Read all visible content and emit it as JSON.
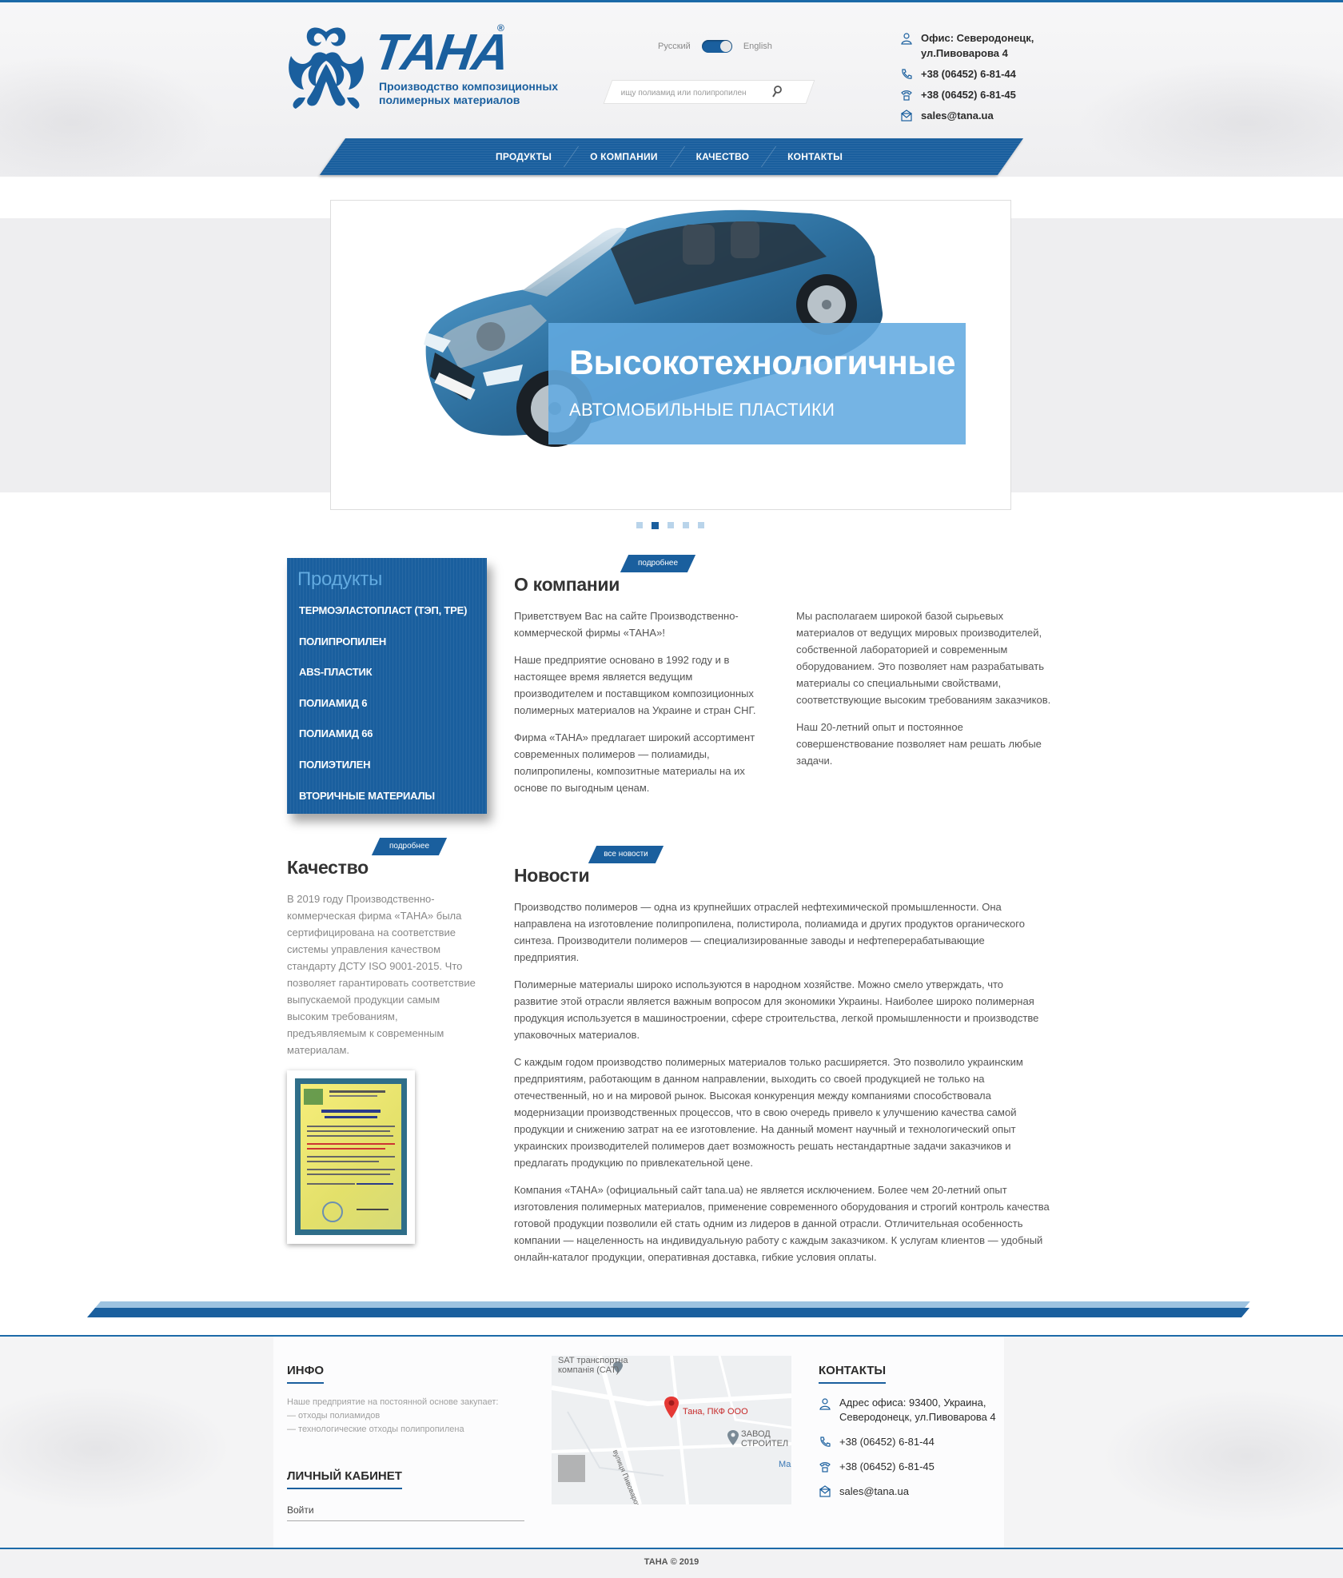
{
  "brand": {
    "logo_word": "ТАНА",
    "registered": "®",
    "tagline": "Производство композиционных полимерных материалов",
    "primary_color": "#1a5f9e",
    "accent_color": "#62aae0"
  },
  "language": {
    "ru": "Русский",
    "en": "English"
  },
  "search": {
    "placeholder": "ищу полиамид или полипропилен"
  },
  "header_contacts": {
    "office": "Офис: Северодонецк, ул.Пивоварова 4",
    "phone1": "+38 (06452) 6-81-44",
    "phone2": "+38 (06452) 6-81-45",
    "email": "sales@tana.ua"
  },
  "nav": {
    "items": [
      "ПРОДУКТЫ",
      "О КОМПАНИИ",
      "КАЧЕСТВО",
      "КОНТАКТЫ"
    ]
  },
  "slider": {
    "title": "Высокотехнологичные",
    "subtitle": "АВТОМОБИЛЬНЫЕ ПЛАСТИКИ",
    "active_index": 1,
    "count": 5
  },
  "products": {
    "title": "Продукты",
    "items": [
      "ТЕРМОЭЛАСТОПЛАСТ (ТЭП, TPE)",
      "ПОЛИПРОПИЛЕН",
      "ABS-ПЛАСТИК",
      "ПОЛИАМИД 6",
      "ПОЛИАМИД 66",
      "ПОЛИЭТИЛЕН",
      "ВТОРИЧНЫЕ МАТЕРИАЛЫ"
    ]
  },
  "about": {
    "tag": "подробнее",
    "title": "О компании",
    "col1": [
      "Приветствуем Вас на сайте Производственно-коммерческой фирмы «ТАНА»!",
      "Наше предприятие основано в 1992 году и в настоящее время является ведущим производителем и поставщиком композиционных полимерных материалов на Украине и стран СНГ.",
      "Фирма «ТАНА» предлагает широкий ассортимент современных полимеров — полиамиды, полипропилены, композитные материалы на их основе по выгодным ценам."
    ],
    "col2": [
      "Мы располагаем широкой базой сырьевых материалов от ведущих мировых производителей, собственной лабораторией и современным оборудованием. Это позволяет нам разрабатывать материалы со специальными свойствами, соответствующие высоким требованиям заказчиков.",
      "Наш 20-летний опыт и постоянное совершенствование позволяет нам решать любые задачи."
    ]
  },
  "quality": {
    "tag": "подробнее",
    "title": "Качество",
    "text": "В 2019 году Производственно-коммерческая фирма «ТАНА» была сертифицирована на соответствие системы управления качеством стандарту ДСТУ ISO 9001-2015. Что позволяет гарантировать соответствие выпускаемой продукции самым высоким требованиям, предъявляемым к современным материалам."
  },
  "news": {
    "tag": "все новости",
    "title": "Новости",
    "paragraphs": [
      "Производство полимеров — одна из крупнейших отраслей нефтехимической промышленности. Она направлена на изготовление полипропилена, полистирола, полиамида и других продуктов органического синтеза. Производители полимеров — специализированные заводы и нефтеперерабатывающие предприятия.",
      "Полимерные материалы широко используются в народном хозяйстве. Можно смело утверждать, что развитие этой отрасли является важным вопросом для экономики Украины. Наиболее широко полимерная продукция используется в машиностроении, сфере строительства, легкой промышленности и производстве упаковочных материалов.",
      "С каждым годом производство полимерных материалов только расширяется. Это позволило украинским предприятиям, работающим в данном направлении, выходить со своей продукцией не только на отечественный, но и на мировой рынок. Высокая конкуренция между компаниями способствовала модернизации производственных процессов, что в свою очередь привело к улучшению качества самой продукции и снижению затрат на ее изготовление. На данный момент научный и технологический опыт украинских производителей полимеров дает возможность решать нестандартные задачи заказчиков и предлагать продукцию по привлекательной цене.",
      "Компания «ТАНА» (официальный сайт tana.ua) не является исключением. Более чем 20-летний опыт изготовления полимерных материалов, применение современного оборудования и строгий контроль качества готовой продукции позволили ей стать одним из лидеров в данной отрасли. Отличительная особенность компании — нацеленность на индивидуальную работу с каждым заказчиком. К услугам клиентов — удобный онлайн-каталог продукции, оперативная доставка, гибкие условия оплаты."
    ]
  },
  "footer": {
    "info_title": "ИНФО",
    "info_lines": [
      "Наше предприятие на постоянной основе закупает:",
      "— отходы полиамидов",
      "— технологические отходы полипропилена"
    ],
    "cabinet_title": "ЛИЧНЫЙ КАБИНЕТ",
    "login": "Войти",
    "map": {
      "label_top": "SAT транспортна компанія (САТ)",
      "label_marker": "Тана, ПКФ ООО",
      "label_plant": "ЗАВОД СТРОИТЕЛ",
      "label_street": "вулиця Пивоварова",
      "label_edge": "Ма"
    },
    "contacts_title": "КОНТАКТЫ",
    "address": "Адрес офиса: 93400, Украина, Северодонецк, ул.Пивоварова 4",
    "phone1": "+38 (06452) 6-81-44",
    "phone2": "+38 (06452) 6-81-45",
    "email": "sales@tana.ua",
    "copyright": "ТАНА © 2019"
  }
}
